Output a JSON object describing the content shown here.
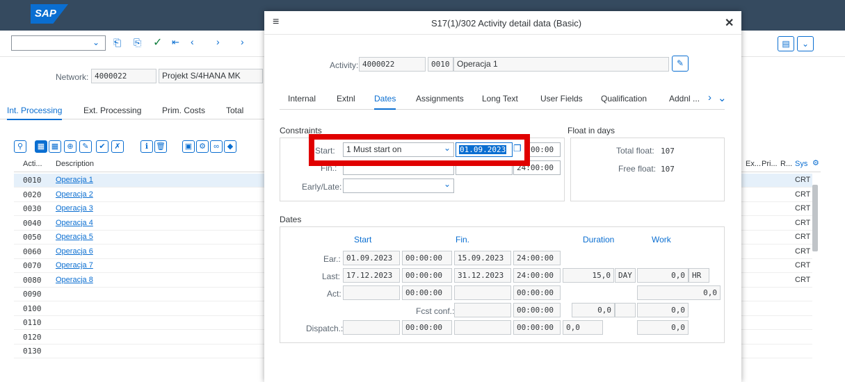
{
  "bg": {
    "logo": "SAP",
    "network_label": "Network:",
    "network_value": "4000022",
    "network_desc": "Projekt S/4HANA MK",
    "tabs": [
      "Int. Processing",
      "Ext. Processing",
      "Prim. Costs",
      "Total"
    ],
    "col_acti": "Acti...",
    "col_desc": "Description",
    "col_ex": "Ex...",
    "col_pri": "Pri...",
    "col_r": "R...",
    "col_sys": "Sys",
    "rows": [
      {
        "num": "0010",
        "desc": "Operacja 1",
        "sys": "CRTI"
      },
      {
        "num": "0020",
        "desc": "Operacja 2",
        "sys": "CRTI"
      },
      {
        "num": "0030",
        "desc": "Operacja 3",
        "sys": "CRTI"
      },
      {
        "num": "0040",
        "desc": "Operacja 4",
        "sys": "CRTI"
      },
      {
        "num": "0050",
        "desc": "Operacja 5",
        "sys": "CRTI"
      },
      {
        "num": "0060",
        "desc": "Operacja 6",
        "sys": "CRTI"
      },
      {
        "num": "0070",
        "desc": "Operacja 7",
        "sys": "CRTI"
      },
      {
        "num": "0080",
        "desc": "Operacja 8",
        "sys": "CRTI"
      },
      {
        "num": "0090",
        "desc": "",
        "sys": ""
      },
      {
        "num": "0100",
        "desc": "",
        "sys": ""
      },
      {
        "num": "0110",
        "desc": "",
        "sys": ""
      },
      {
        "num": "0120",
        "desc": "",
        "sys": ""
      },
      {
        "num": "0130",
        "desc": "",
        "sys": ""
      }
    ]
  },
  "dialog": {
    "title": "S17(1)/302 Activity detail data (Basic)",
    "activity_label": "Activity:",
    "activity_value": "4000022",
    "op_value": "0010",
    "op_desc": "Operacja 1",
    "tabs": [
      "Internal",
      "Extnl",
      "Dates",
      "Assignments",
      "Long Text",
      "User Fields",
      "Qualification",
      "Addnl ..."
    ],
    "constraints_title": "Constraints",
    "float_title": "Float in days",
    "start_label": "Start:",
    "start_type": "1 Must start on",
    "start_date": "01.09.2023",
    "start_time": "00:00",
    "fin_label": "Fin.:",
    "fin_time": "24:00:00",
    "early_late_label": "Early/Late:",
    "total_float_label": "Total float:",
    "total_float_value": "107",
    "free_float_label": "Free float:",
    "free_float_value": "107",
    "dates_title": "Dates",
    "col_start": "Start",
    "col_fin": "Fin.",
    "col_duration": "Duration",
    "col_work": "Work",
    "ear_label": "Ear.:",
    "ear_start_date": "01.09.2023",
    "ear_start_time": "00:00:00",
    "ear_fin_date": "15.09.2023",
    "ear_fin_time": "24:00:00",
    "last_label": "Last:",
    "last_start_date": "17.12.2023",
    "last_start_time": "00:00:00",
    "last_fin_date": "31.12.2023",
    "last_fin_time": "24:00:00",
    "duration_value": "15,0",
    "duration_unit": "DAY",
    "work_value": "0,0",
    "work_unit": "HR",
    "act_label": "Act:",
    "act_start_time": "00:00:00",
    "act_fin_time": "00:00:00",
    "act_work": "0,0",
    "fcst_label": "Fcst conf.:",
    "fcst_time": "00:00:00",
    "fcst_val1": "0,0",
    "fcst_val2": "0,0",
    "dispatch_label": "Dispatch.:",
    "dispatch_start_time": "00:00:00",
    "dispatch_fin_time": "00:00:00",
    "dispatch_val1": "0,0",
    "dispatch_val2": "0,0"
  },
  "colors": {
    "highlight_box": "#e00000",
    "accent": "#0a6ed1",
    "header_bg": "#354a5f"
  }
}
